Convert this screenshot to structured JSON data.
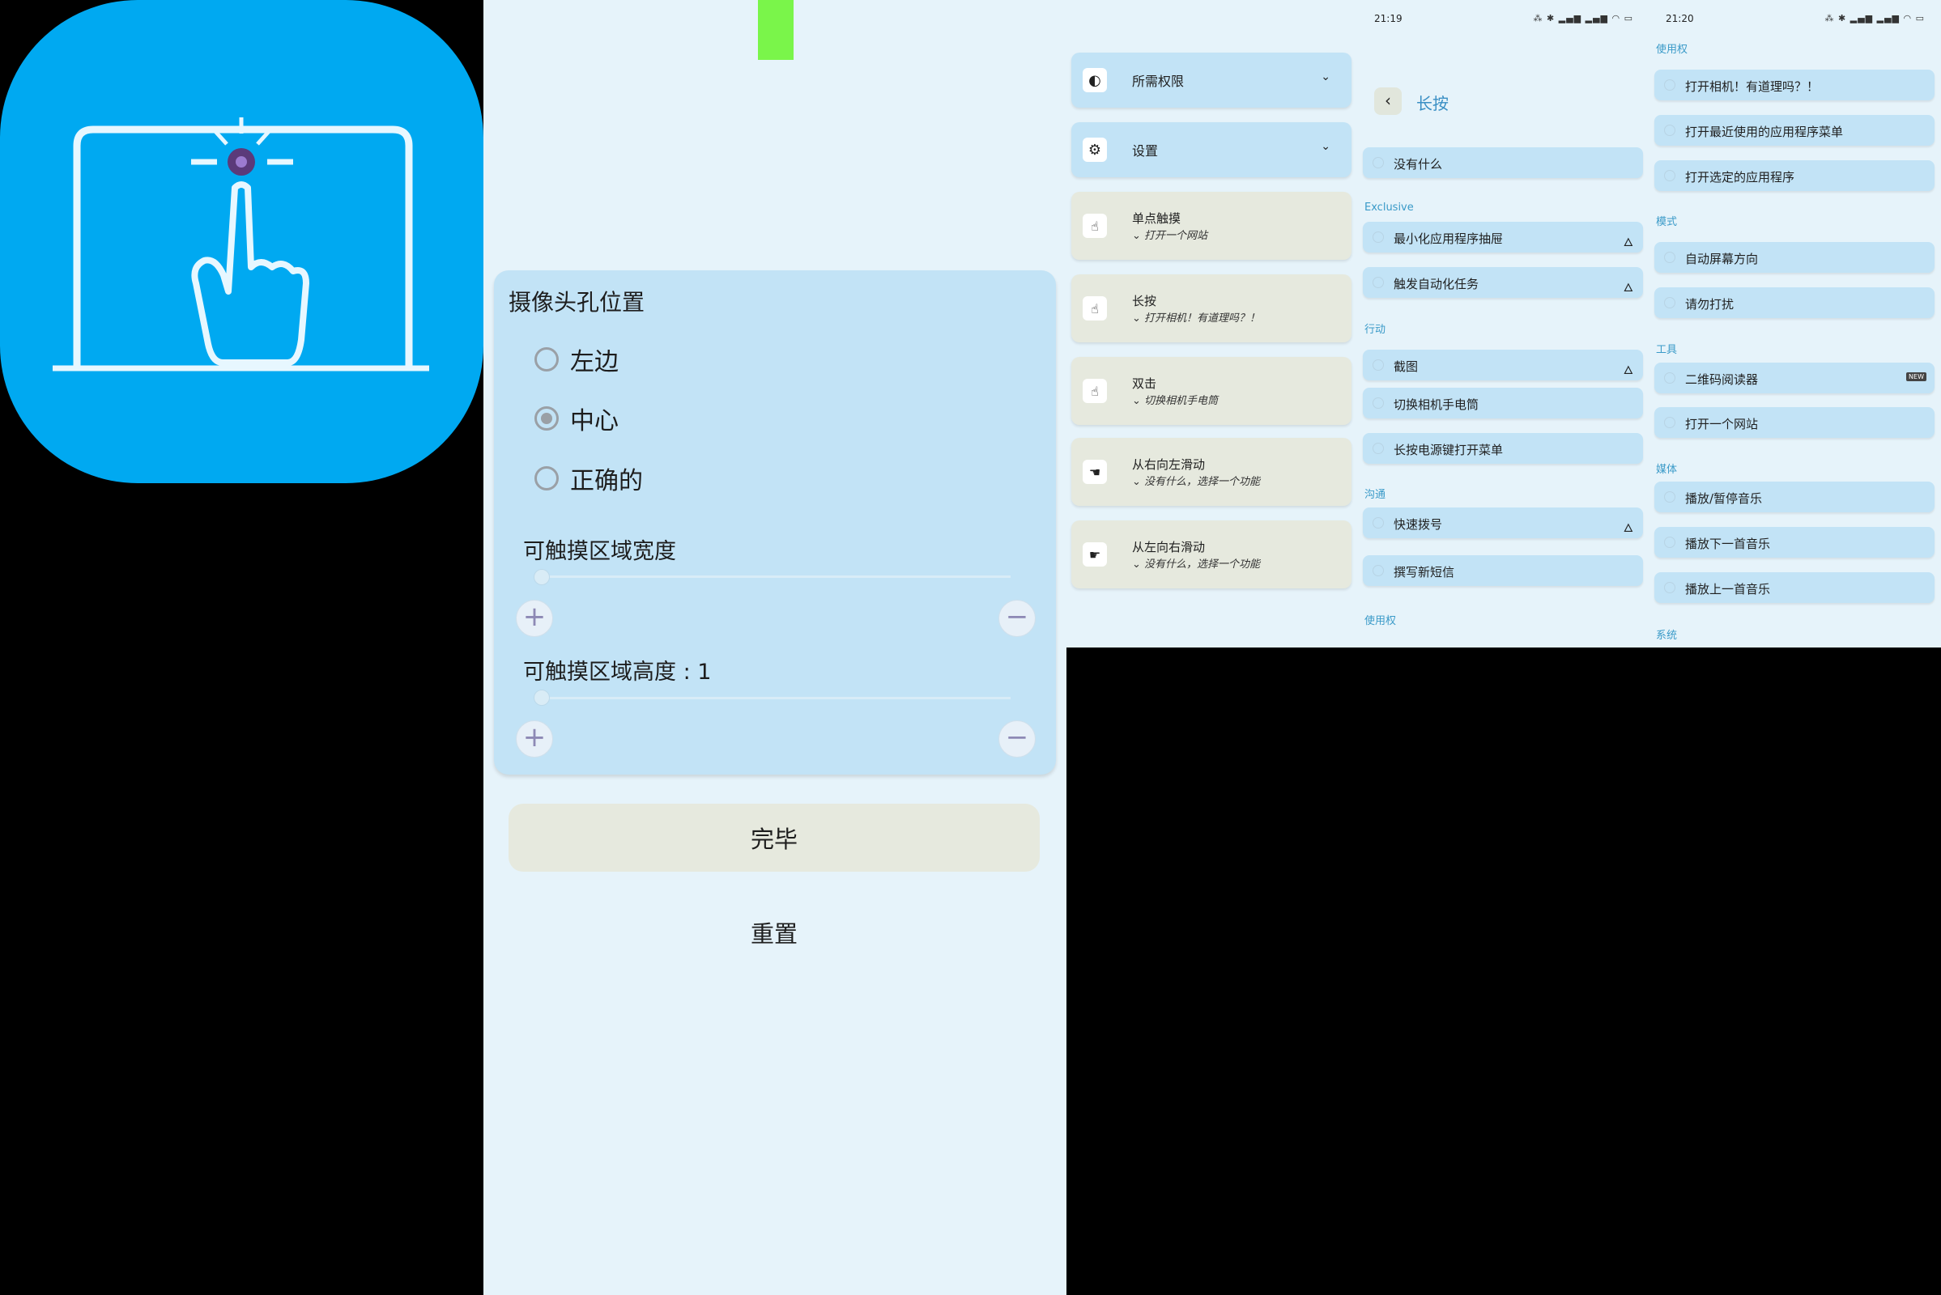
{
  "settings": {
    "card_title": "摄像头孔位置",
    "radios": [
      {
        "label": "左边",
        "checked": false
      },
      {
        "label": "中心",
        "checked": true
      },
      {
        "label": "正确的",
        "checked": false
      }
    ],
    "width_label": "可触摸区域宽度",
    "height_label": "可触摸区域高度 : 1",
    "plus": "+",
    "minus": "−",
    "done": "完毕",
    "reset": "重置"
  },
  "gestures": {
    "permissions": "所需权限",
    "settings": "设置",
    "items": [
      {
        "title": "单点触摸",
        "subtitle": "打开一个网站"
      },
      {
        "title": "长按",
        "subtitle": "打开相机！有道理吗？！"
      },
      {
        "title": "双击",
        "subtitle": "切换相机手电筒"
      },
      {
        "title": "从右向左滑动",
        "subtitle": "没有什么，选择一个功能"
      },
      {
        "title": "从左向右滑动",
        "subtitle": "没有什么，选择一个功能"
      }
    ]
  },
  "long_press": {
    "time": "21:19",
    "status_icons": "⁂ ✱ ▂▄▆ ▂▄▆ ◠ ▭",
    "back": "‹",
    "title": "长按",
    "none": "没有什么",
    "sections": [
      {
        "label": "Exclusive",
        "items": [
          {
            "label": "最小化应用程序抽屉",
            "flame": true
          },
          {
            "label": "触发自动化任务",
            "flame": true
          }
        ]
      },
      {
        "label": "行动",
        "items": [
          {
            "label": "截图",
            "flame": true
          },
          {
            "label": "切换相机手电筒",
            "flame": false
          },
          {
            "label": "长按电源键打开菜单",
            "flame": false
          }
        ]
      },
      {
        "label": "沟通",
        "items": [
          {
            "label": "快速拨号",
            "flame": true
          },
          {
            "label": "撰写新短信",
            "flame": false
          }
        ]
      },
      {
        "label": "使用权",
        "items": []
      }
    ]
  },
  "actions": {
    "time": "21:20",
    "status_icons": "⁂ ✱ ▂▄▆ ▂▄▆ ◠ ▭",
    "sections": [
      {
        "label": "使用权",
        "items": [
          {
            "label": "打开相机！有道理吗？！"
          },
          {
            "label": "打开最近使用的应用程序菜单"
          },
          {
            "label": "打开选定的应用程序"
          }
        ]
      },
      {
        "label": "模式",
        "items": [
          {
            "label": "自动屏幕方向"
          },
          {
            "label": "请勿打扰"
          }
        ]
      },
      {
        "label": "工具",
        "items": [
          {
            "label": "二维码阅读器",
            "badge": "NEW"
          },
          {
            "label": "打开一个网站"
          }
        ]
      },
      {
        "label": "媒体",
        "items": [
          {
            "label": "播放/暂停音乐"
          },
          {
            "label": "播放下一首音乐"
          },
          {
            "label": "播放上一首音乐"
          }
        ]
      },
      {
        "label": "系统",
        "items": []
      }
    ]
  },
  "colors": {
    "icon_bg": "#00a9f1",
    "card_blue": "#c2e3f6",
    "card_beige": "#e6e9de",
    "page_bg": "#e6f3fa",
    "accent": "#3a9ac8"
  }
}
